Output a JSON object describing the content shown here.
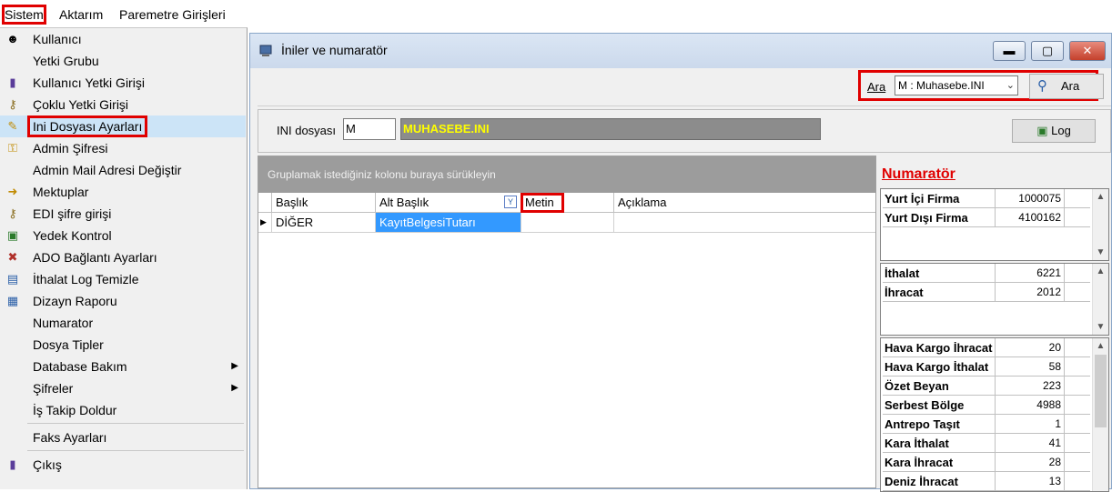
{
  "menubar": {
    "items": [
      "Sistem",
      "Aktarım",
      "Paremetre Girişleri"
    ]
  },
  "menu": {
    "items": [
      {
        "label": "Kullanıcı",
        "icon": "user-icon"
      },
      {
        "label": "Yetki Grubu",
        "icon": ""
      },
      {
        "label": "Kullanıcı Yetki Girişi",
        "icon": "user-key-icon"
      },
      {
        "label": "Çoklu Yetki Girişi",
        "icon": "multi-key-icon"
      },
      {
        "label": "Ini Dosyası  Ayarları",
        "icon": "ini-settings-icon"
      },
      {
        "label": "Admin Şifresi",
        "icon": "key-icon"
      },
      {
        "label": "Admin Mail Adresi Değiştir",
        "icon": ""
      },
      {
        "label": "Mektuplar",
        "icon": "letter-icon"
      },
      {
        "label": "EDI şifre girişi",
        "icon": "edi-key-icon"
      },
      {
        "label": "Yedek Kontrol",
        "icon": "backup-icon"
      },
      {
        "label": "ADO Bağlantı Ayarları",
        "icon": "connection-icon"
      },
      {
        "label": "İthalat Log Temizle",
        "icon": "log-clean-icon"
      },
      {
        "label": "Dizayn Raporu",
        "icon": "report-icon"
      },
      {
        "label": "Numarator",
        "icon": ""
      },
      {
        "label": "Dosya Tipler",
        "icon": ""
      },
      {
        "label": "Database Bakım",
        "icon": ""
      },
      {
        "label": "Şifreler",
        "icon": ""
      },
      {
        "label": "İş Takip Doldur",
        "icon": ""
      },
      {
        "label": "Faks Ayarları",
        "icon": ""
      },
      {
        "label": "Çıkış",
        "icon": "exit-icon"
      }
    ]
  },
  "window": {
    "title": "İniler ve numaratör",
    "search": {
      "label": "Ara",
      "selected": "M : Muhasebe.INI",
      "button_label": "Ara"
    },
    "ini": {
      "label": "INI dosyası",
      "code": "M",
      "name": "MUHASEBE.INI",
      "log_button": "Log"
    },
    "grid": {
      "group_hint": "Gruplamak istediğiniz kolonu buraya sürükleyin",
      "columns": [
        "Başlık",
        "Alt Başlık",
        "Metin",
        "Açıklama"
      ],
      "rows": [
        {
          "baslik": "DİĞER",
          "alt_baslik": "KayıtBelgesiTutarı",
          "metin": "",
          "aciklama": ""
        }
      ]
    },
    "numarator": {
      "title": "Numaratör",
      "group1": [
        {
          "k": "Yurt İçi Firma",
          "v": "1000075"
        },
        {
          "k": "Yurt Dışı Firma",
          "v": "4100162"
        }
      ],
      "group2": [
        {
          "k": "İthalat",
          "v": "6221"
        },
        {
          "k": "İhracat",
          "v": "2012"
        }
      ],
      "group3": [
        {
          "k": "Hava Kargo İhracat",
          "v": "20"
        },
        {
          "k": "Hava Kargo İthalat",
          "v": "58"
        },
        {
          "k": "Özet Beyan",
          "v": "223"
        },
        {
          "k": "Serbest Bölge",
          "v": "4988"
        },
        {
          "k": "Antrepo Taşıt",
          "v": "1"
        },
        {
          "k": "Kara İthalat",
          "v": "41"
        },
        {
          "k": "Kara İhracat",
          "v": "28"
        },
        {
          "k": "Deniz İhracat",
          "v": "13"
        }
      ]
    }
  }
}
